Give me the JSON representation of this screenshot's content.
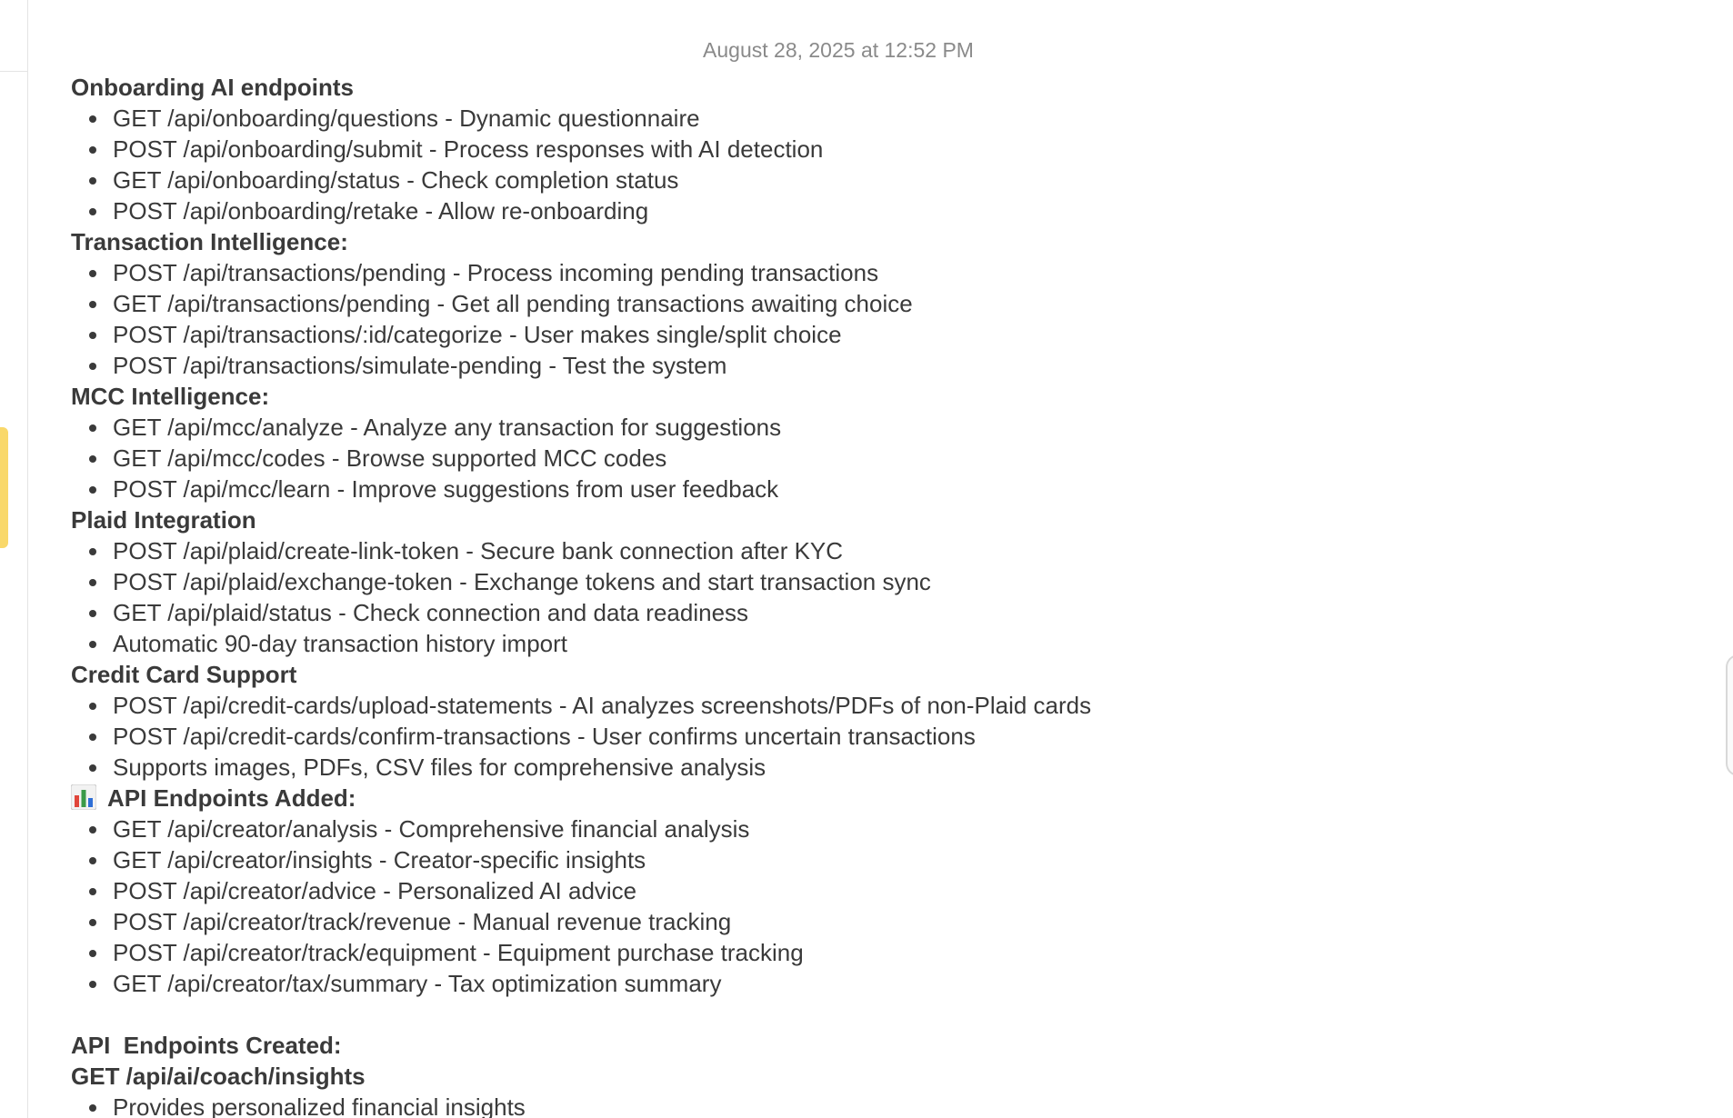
{
  "note": {
    "timestamp": "August 28, 2025 at 12:52 PM",
    "sections": [
      {
        "title": "Onboarding AI endpoints",
        "items": [
          "GET /api/onboarding/questions - Dynamic questionnaire",
          "POST /api/onboarding/submit - Process responses with AI detection",
          "GET /api/onboarding/status - Check completion status",
          "POST /api/onboarding/retake - Allow re-onboarding"
        ]
      },
      {
        "title": "Transaction Intelligence:",
        "items": [
          "POST /api/transactions/pending - Process incoming pending transactions",
          "GET /api/transactions/pending - Get all pending transactions awaiting choice",
          "POST /api/transactions/:id/categorize - User makes single/split choice",
          "POST /api/transactions/simulate-pending - Test the system"
        ]
      },
      {
        "title": "MCC Intelligence:",
        "items": [
          "GET /api/mcc/analyze - Analyze any transaction for suggestions",
          "GET /api/mcc/codes - Browse supported MCC codes",
          "POST /api/mcc/learn - Improve suggestions from user feedback"
        ]
      },
      {
        "title": "Plaid Integration",
        "items": [
          "POST /api/plaid/create-link-token - Secure bank connection after KYC",
          "POST /api/plaid/exchange-token - Exchange tokens and start transaction sync",
          "GET /api/plaid/status - Check connection and data readiness",
          "Automatic 90-day transaction history import"
        ]
      },
      {
        "title": "Credit Card Support",
        "items": [
          "POST /api/credit-cards/upload-statements - AI analyzes screenshots/PDFs of non-Plaid cards",
          "POST /api/credit-cards/confirm-transactions - User confirms uncertain transactions",
          "Supports images, PDFs, CSV files for comprehensive analysis"
        ]
      },
      {
        "title": "API Endpoints Added:",
        "icon": "bar-chart-emoji",
        "items": [
          "GET /api/creator/analysis - Comprehensive financial analysis",
          "GET /api/creator/insights - Creator-specific insights",
          "POST /api/creator/advice - Personalized AI advice",
          "POST /api/creator/track/revenue - Manual revenue tracking",
          "POST /api/creator/track/equipment - Equipment purchase tracking",
          "GET /api/creator/tax/summary - Tax optimization summary"
        ]
      },
      {
        "title": "API  Endpoints Created:",
        "items": []
      },
      {
        "title": "GET /api/ai/coach/insights",
        "items": [
          "Provides personalized financial insights"
        ]
      }
    ]
  }
}
